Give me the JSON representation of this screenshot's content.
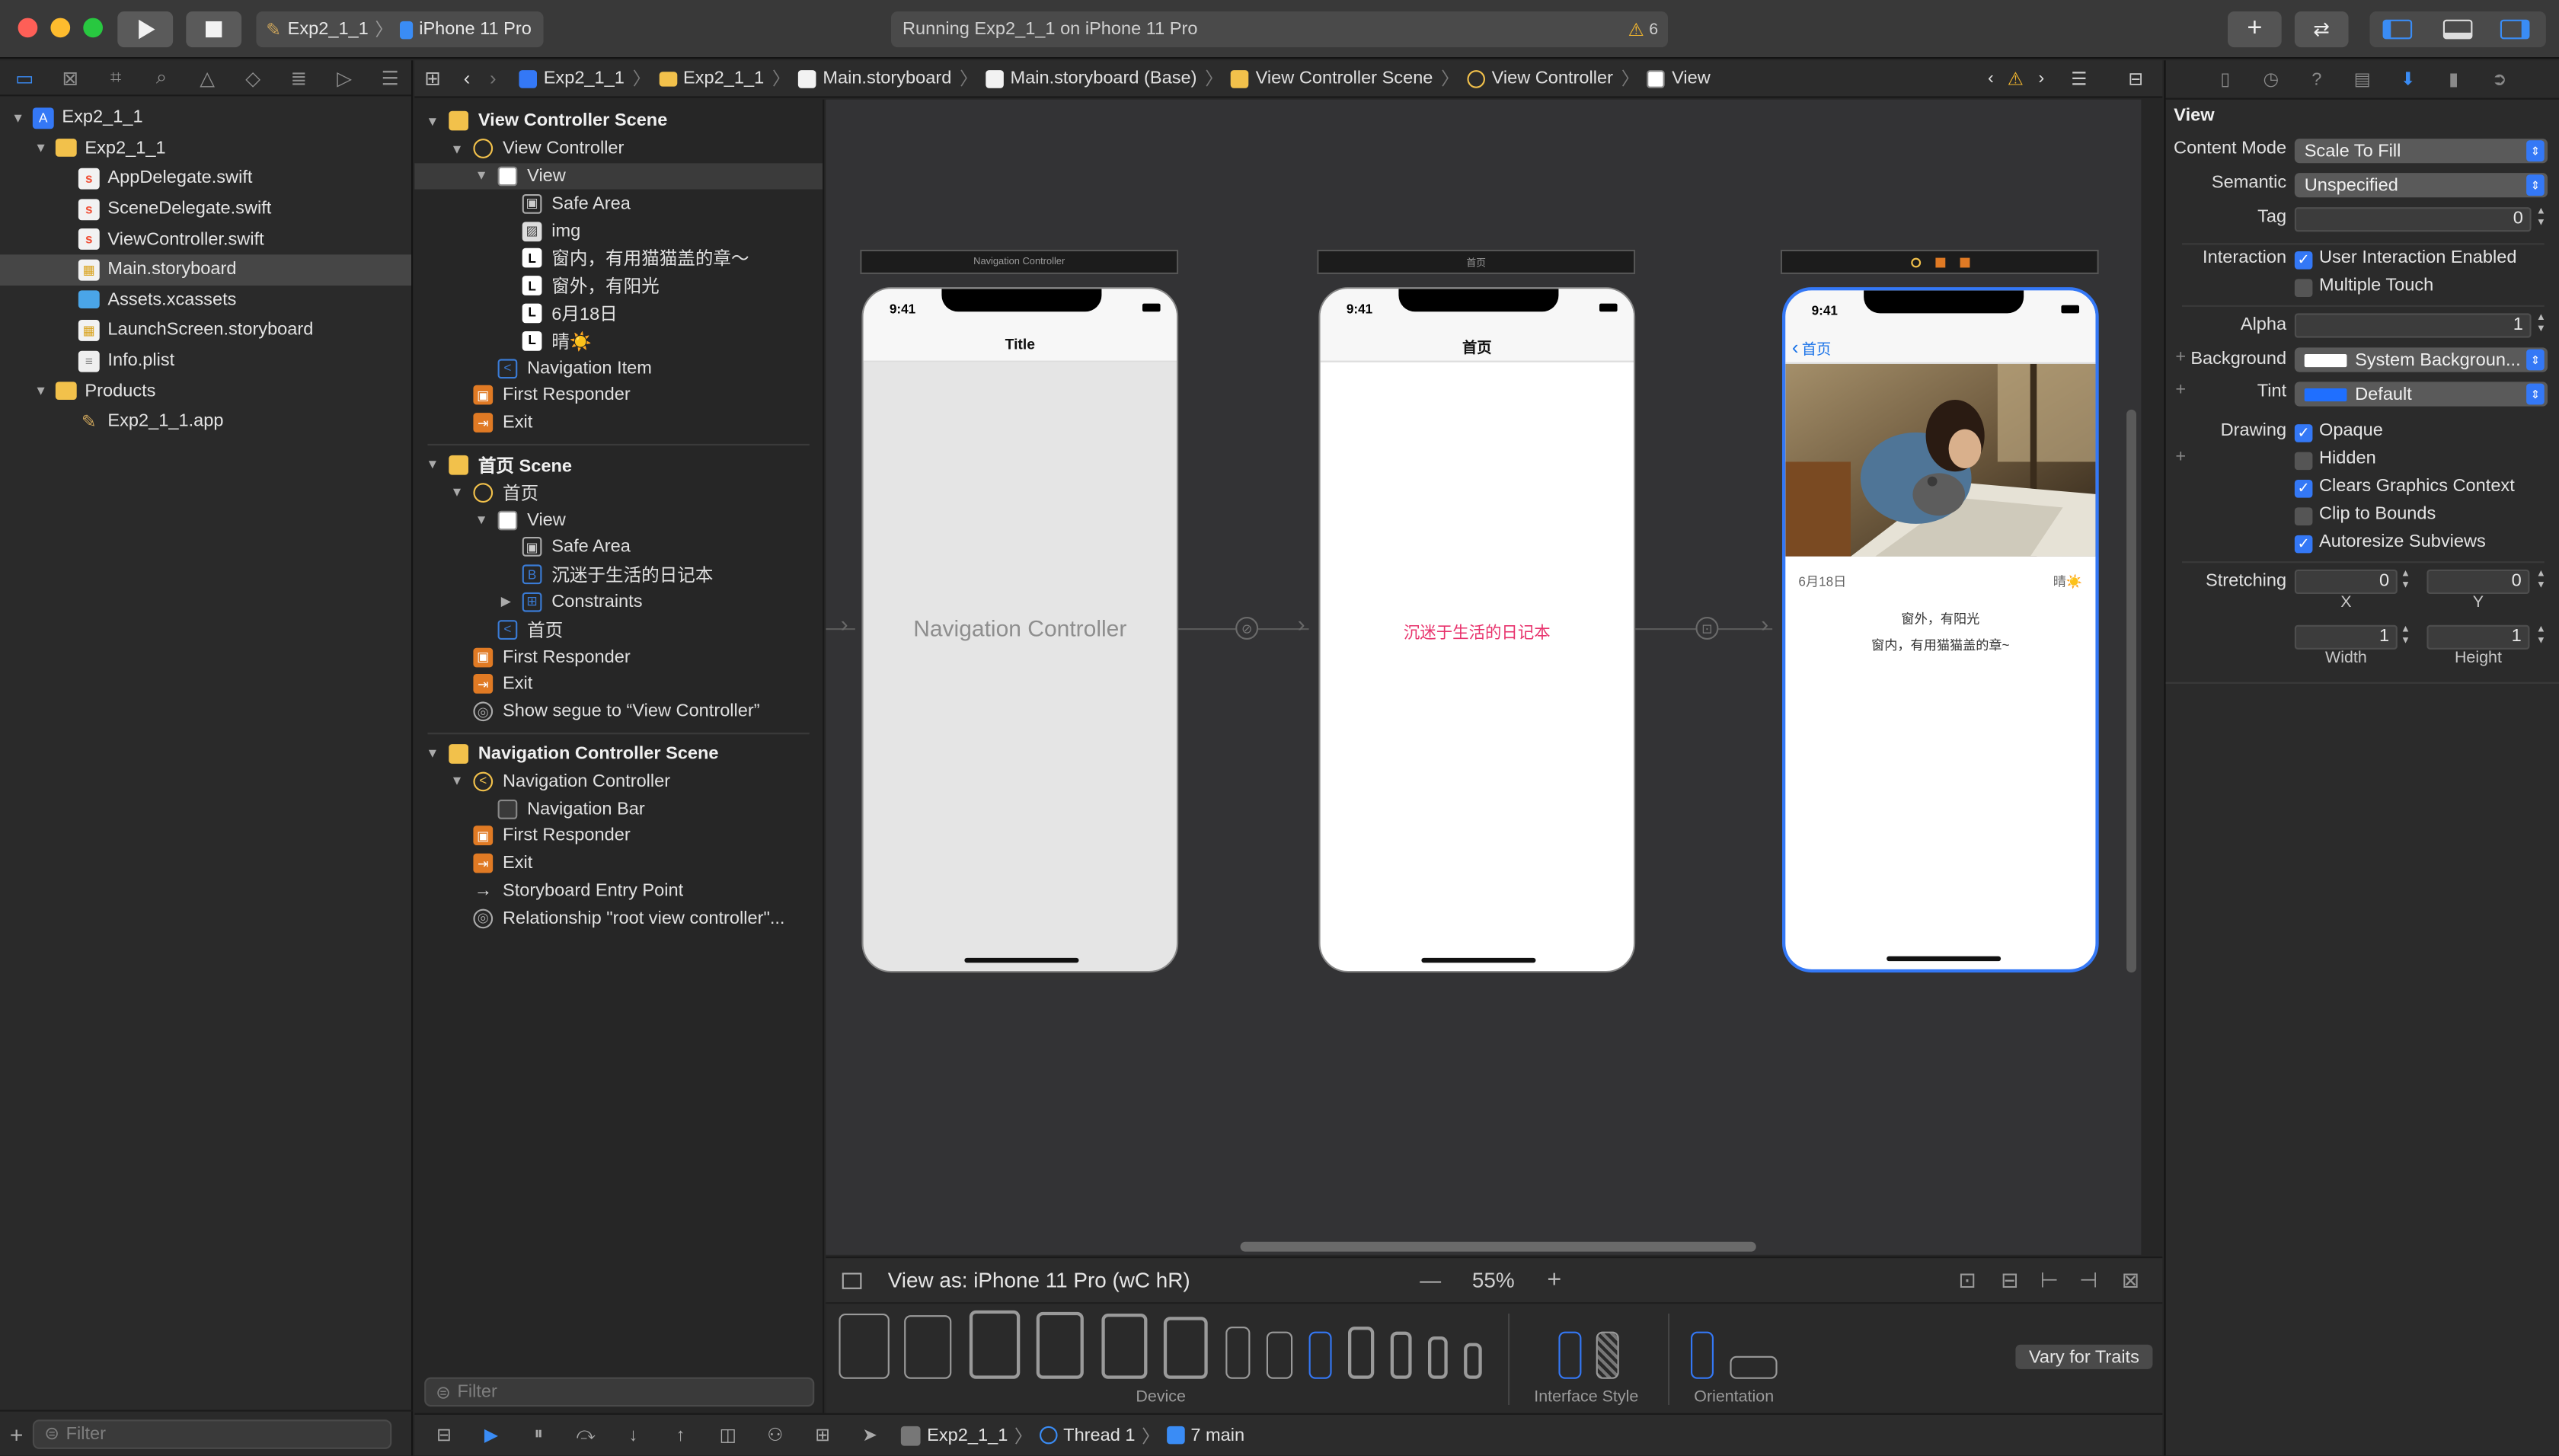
{
  "toolbar": {
    "scheme_app": "Exp2_1_1",
    "scheme_device": "iPhone 11 Pro",
    "activity_text": "Running Exp2_1_1 on iPhone 11 Pro",
    "warning_count": "6"
  },
  "navigator": {
    "items": [
      {
        "label": "Exp2_1_1",
        "indent": 0,
        "icon": "project-icon",
        "disclosure": "open"
      },
      {
        "label": "Exp2_1_1",
        "indent": 1,
        "icon": "folder-icon",
        "disclosure": "open"
      },
      {
        "label": "AppDelegate.swift",
        "indent": 2,
        "icon": "swift-file-icon"
      },
      {
        "label": "SceneDelegate.swift",
        "indent": 2,
        "icon": "swift-file-icon"
      },
      {
        "label": "ViewController.swift",
        "indent": 2,
        "icon": "swift-file-icon"
      },
      {
        "label": "Main.storyboard",
        "indent": 2,
        "icon": "storyboard-file-icon",
        "selected": true
      },
      {
        "label": "Assets.xcassets",
        "indent": 2,
        "icon": "asset-catalog-icon"
      },
      {
        "label": "LaunchScreen.storyboard",
        "indent": 2,
        "icon": "storyboard-file-icon"
      },
      {
        "label": "Info.plist",
        "indent": 2,
        "icon": "plist-file-icon"
      },
      {
        "label": "Products",
        "indent": 1,
        "icon": "folder-icon",
        "disclosure": "open"
      },
      {
        "label": "Exp2_1_1.app",
        "indent": 2,
        "icon": "app-icon"
      }
    ],
    "filter_placeholder": "Filter"
  },
  "jumpbar": {
    "crumbs": [
      "Exp2_1_1",
      "Exp2_1_1",
      "Main.storyboard",
      "Main.storyboard (Base)",
      "View Controller Scene",
      "View Controller",
      "View"
    ]
  },
  "outline": {
    "items": [
      {
        "label": "View Controller Scene",
        "indent": 0,
        "icon": "scene",
        "scene": true,
        "disclosure": "open"
      },
      {
        "label": "View Controller",
        "indent": 1,
        "icon": "vc",
        "disclosure": "open"
      },
      {
        "label": "View",
        "indent": 2,
        "icon": "view",
        "disclosure": "open",
        "selected": true
      },
      {
        "label": "Safe Area",
        "indent": 3,
        "icon": "safe"
      },
      {
        "label": "img",
        "indent": 3,
        "icon": "img"
      },
      {
        "label": "窗内，有用猫猫盖的章～",
        "indent": 3,
        "icon": "label"
      },
      {
        "label": "窗外，有阳光",
        "indent": 3,
        "icon": "label"
      },
      {
        "label": "6月18日",
        "indent": 3,
        "icon": "label"
      },
      {
        "label": "晴☀️",
        "indent": 3,
        "icon": "label"
      },
      {
        "label": "Navigation Item",
        "indent": 2,
        "icon": "navitem"
      },
      {
        "label": "First Responder",
        "indent": 1,
        "icon": "resp"
      },
      {
        "label": "Exit",
        "indent": 1,
        "icon": "exit"
      },
      {
        "sep": true
      },
      {
        "label": "首页 Scene",
        "indent": 0,
        "icon": "scene",
        "scene": true,
        "disclosure": "open"
      },
      {
        "label": "首页",
        "indent": 1,
        "icon": "vc",
        "disclosure": "open"
      },
      {
        "label": "View",
        "indent": 2,
        "icon": "view",
        "disclosure": "open"
      },
      {
        "label": "Safe Area",
        "indent": 3,
        "icon": "safe"
      },
      {
        "label": "沉迷于生活的日记本",
        "indent": 3,
        "icon": "button"
      },
      {
        "label": "Constraints",
        "indent": 3,
        "icon": "cons",
        "disclosure": "closed"
      },
      {
        "label": "首页",
        "indent": 2,
        "icon": "navitem"
      },
      {
        "label": "First Responder",
        "indent": 1,
        "icon": "resp"
      },
      {
        "label": "Exit",
        "indent": 1,
        "icon": "exit"
      },
      {
        "label": "Show segue to “View Controller”",
        "indent": 1,
        "icon": "segue"
      },
      {
        "sep": true
      },
      {
        "label": "Navigation Controller Scene",
        "indent": 0,
        "icon": "scene",
        "scene": true,
        "disclosure": "open"
      },
      {
        "label": "Navigation Controller",
        "indent": 1,
        "icon": "nav",
        "disclosure": "open"
      },
      {
        "label": "Navigation Bar",
        "indent": 2,
        "icon": "navbar"
      },
      {
        "label": "First Responder",
        "indent": 1,
        "icon": "resp"
      },
      {
        "label": "Exit",
        "indent": 1,
        "icon": "exit"
      },
      {
        "label": "Storyboard Entry Point",
        "indent": 1,
        "icon": "entry"
      },
      {
        "label": "Relationship \"root view controller\"...",
        "indent": 1,
        "icon": "segue"
      }
    ],
    "filter_placeholder": "Filter"
  },
  "canvas": {
    "nav_header": "Navigation Controller",
    "nav_title": "Title",
    "nav_placeholder": "Navigation Controller",
    "home_header": "首页",
    "home_title": "首页",
    "home_button": "沉迷于生活的日记本",
    "vc_back": "首页",
    "vc_date": "6月18日",
    "vc_weather": "晴☀️",
    "vc_line1": "窗外，有阳光",
    "vc_line2": "窗内，有用猫猫盖的章~",
    "status_time": "9:41"
  },
  "viewas": {
    "label": "View as: iPhone 11 Pro (wC hR)",
    "zoom": "55%",
    "minus": "—",
    "plus": "+"
  },
  "devices": {
    "device_label": "Device",
    "style_label": "Interface Style",
    "orientation_label": "Orientation",
    "vary_button": "Vary for Traits"
  },
  "debug": {
    "target": "Exp2_1_1",
    "thread": "Thread 1",
    "frame": "7 main"
  },
  "inspector": {
    "section": "View",
    "content_mode_label": "Content Mode",
    "content_mode": "Scale To Fill",
    "semantic_label": "Semantic",
    "semantic": "Unspecified",
    "tag_label": "Tag",
    "tag": "0",
    "interaction_label": "Interaction",
    "user_interaction": "User Interaction Enabled",
    "multiple_touch": "Multiple Touch",
    "alpha_label": "Alpha",
    "alpha": "1",
    "background_label": "Background",
    "background": "System Backgroun...",
    "tint_label": "Tint",
    "tint": "Default",
    "drawing_label": "Drawing",
    "opaque": "Opaque",
    "hidden": "Hidden",
    "clears": "Clears Graphics Context",
    "clip": "Clip to Bounds",
    "autoresize": "Autoresize Subviews",
    "stretching_label": "Stretching",
    "sx": "0",
    "sy": "0",
    "sw": "1",
    "sh": "1",
    "x_label": "X",
    "y_label": "Y",
    "w_label": "Width",
    "h_label": "Height"
  },
  "colors": {
    "accent": "#3478f6",
    "home_button_text": "#e8336d",
    "warning": "#f5b82e"
  }
}
